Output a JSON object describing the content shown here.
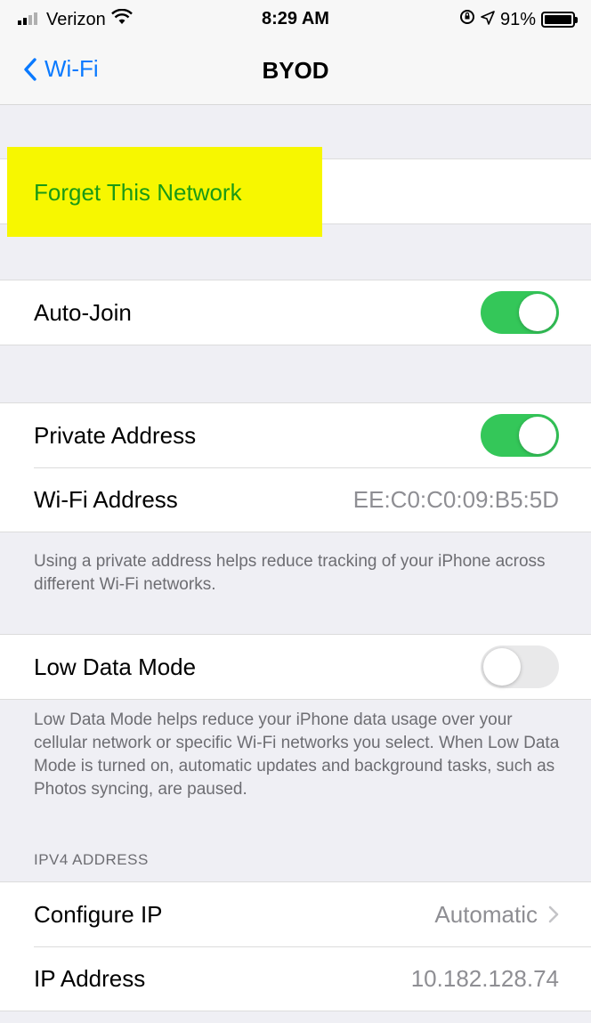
{
  "status_bar": {
    "carrier": "Verizon",
    "time": "8:29 AM",
    "battery": "91%",
    "battery_level": 0.91
  },
  "nav": {
    "back_label": "Wi-Fi",
    "title": "BYOD"
  },
  "forget": {
    "label": "Forget This Network",
    "highlight_color": "#f7f700",
    "text_color": "#1a9a15"
  },
  "auto_join": {
    "label": "Auto-Join",
    "on": true
  },
  "private_address": {
    "label": "Private Address",
    "on": true
  },
  "wifi_address": {
    "label": "Wi-Fi Address",
    "value": "EE:C0:C0:09:B5:5D"
  },
  "private_note": "Using a private address helps reduce tracking of your iPhone across different Wi-Fi networks.",
  "low_data": {
    "label": "Low Data Mode",
    "on": false
  },
  "low_data_note": "Low Data Mode helps reduce your iPhone data usage over your cellular network or specific Wi-Fi networks you select. When Low Data Mode is turned on, automatic updates and background tasks, such as Photos syncing, are paused.",
  "ipv4": {
    "header": "IPV4 ADDRESS",
    "configure_label": "Configure IP",
    "configure_value": "Automatic",
    "ip_label": "IP Address",
    "ip_value": "10.182.128.74"
  },
  "colors": {
    "accent": "#0a7aff",
    "toggle_on": "#34c759",
    "toggle_off": "#e9e9ea"
  }
}
